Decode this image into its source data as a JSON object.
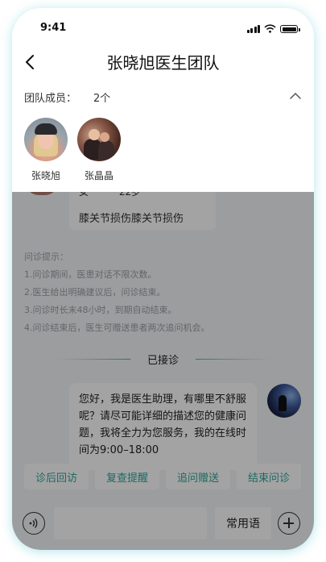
{
  "status_bar": {
    "time": "9:41"
  },
  "nav": {
    "title": "张晓旭医生团队"
  },
  "team": {
    "label": "团队成员：",
    "count": "2个",
    "members": [
      {
        "name": "张晓旭"
      },
      {
        "name": "张晶晶"
      }
    ]
  },
  "chat": {
    "patient": {
      "gender": "女",
      "age": "22岁",
      "diagnosis": "膝关节损伤膝关节损伤"
    },
    "tips": {
      "title": "问诊提示：",
      "lines": [
        "1.问诊期间，医患对话不限次数。",
        "2.医生给出明确建议后，问诊结束。",
        "3.问诊时长末48小时，到期自动结束。",
        "4.问诊结束后，医生可赠送患者两次追问机会。"
      ]
    },
    "divider": "已接诊",
    "assistant_message": "您好，我是医生助理，有哪里不舒服呢？请尽可能详细的描述您的健康问题，我将全力为您服务，我的在线时间为9:00–18:00"
  },
  "quick_actions": [
    "诊后回访",
    "复查提醒",
    "追问赠送",
    "结束问诊"
  ],
  "input": {
    "placeholder": "",
    "phrases_label": "常用语"
  },
  "colors": {
    "accent": "#2fa39c",
    "overlay": "rgba(0,0,0,0.36)"
  }
}
